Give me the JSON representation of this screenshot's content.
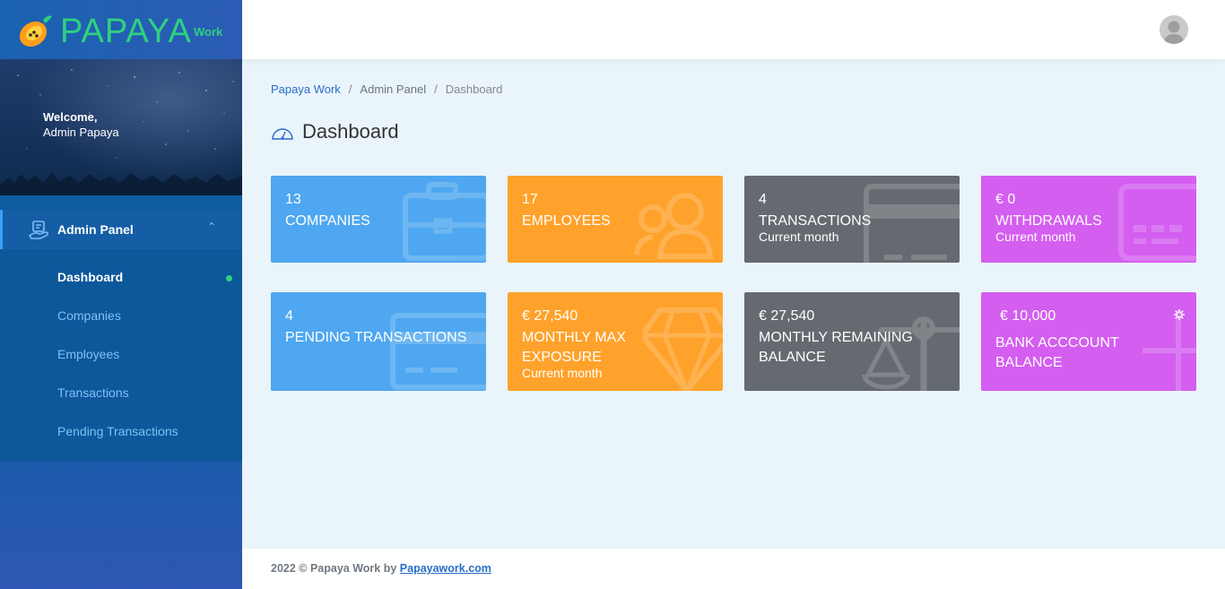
{
  "brand": {
    "name": "PAPAYA",
    "sub": "Work"
  },
  "sidebar": {
    "welcome_line1": "Welcome,",
    "welcome_line2": "Admin Papaya",
    "section": "Admin Panel",
    "items": [
      {
        "label": "Dashboard",
        "active": true
      },
      {
        "label": "Companies"
      },
      {
        "label": "Employees"
      },
      {
        "label": "Transactions"
      },
      {
        "label": "Pending Transactions"
      }
    ]
  },
  "breadcrumb": [
    "Papaya Work",
    "Admin Panel",
    "Dashboard"
  ],
  "page_title": "Dashboard",
  "cards": [
    {
      "value": "13",
      "title": "COMPANIES",
      "subtitle": "",
      "color": "#4ea7f0",
      "icon": "briefcase-icon"
    },
    {
      "value": "17",
      "title": "EMPLOYEES",
      "subtitle": "",
      "color": "#ffa22b",
      "icon": "users-icon"
    },
    {
      "value": "4",
      "title": "TRANSACTIONS",
      "subtitle": "Current month",
      "color": "#646a70",
      "icon": "credit-card-icon"
    },
    {
      "value": "€ 0",
      "title": "WITHDRAWALS",
      "subtitle": "Current month",
      "color": "#d45ef0",
      "icon": "keypad-card-icon"
    },
    {
      "value": "4",
      "title": "PENDING TRANSACTIONS",
      "subtitle": "",
      "color": "#4ea7f0",
      "icon": "credit-card-icon"
    },
    {
      "value": "€ 27,540",
      "title": "MONTHLY MAX EXPOSURE",
      "subtitle": "Current month",
      "color": "#ffa22b",
      "icon": "diamond-icon"
    },
    {
      "value": "€ 27,540",
      "title": "MONTHLY REMAINING BALANCE",
      "subtitle": "",
      "color": "#646a70",
      "icon": "scale-icon"
    },
    {
      "value": "€ 10,000",
      "title": "BANK ACCCOUNT BALANCE",
      "subtitle": "",
      "color": "#d45ef0",
      "icon": "plus-icon"
    }
  ],
  "footer": {
    "text": "2022 © Papaya Work by ",
    "link": "Papayawork.com"
  }
}
